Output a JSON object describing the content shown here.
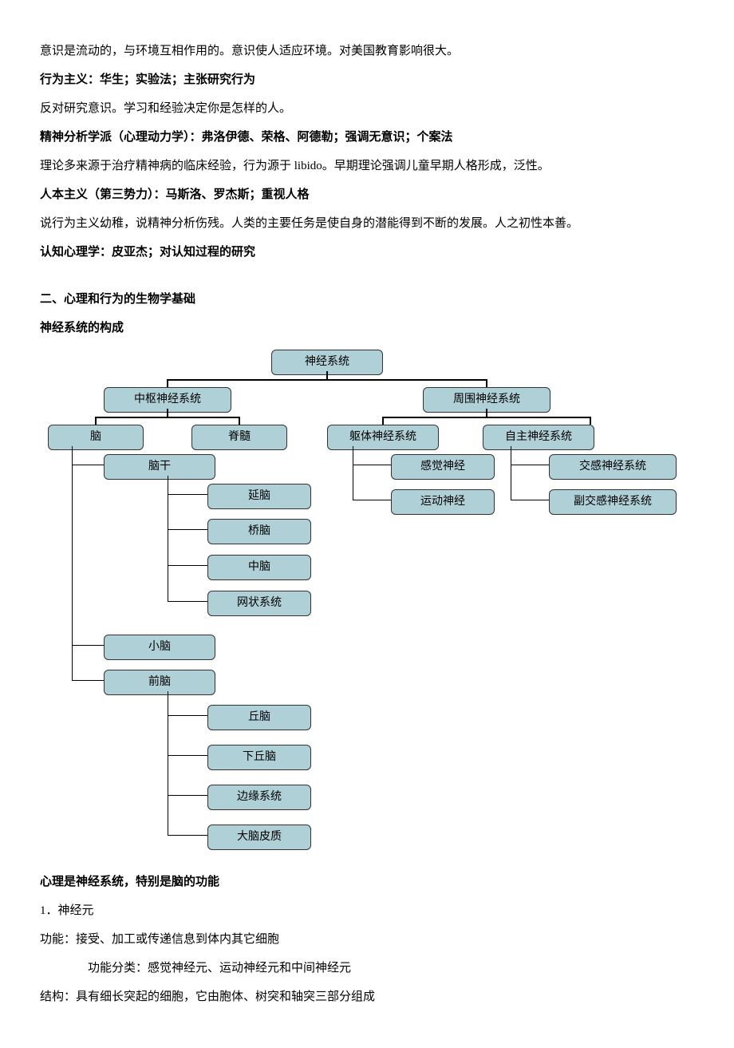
{
  "p1": "意识是流动的，与环境互相作用的。意识使人适应环境。对美国教育影响很大。",
  "h1": "行为主义：华生；实验法；主张研究行为",
  "p2": "反对研究意识。学习和经验决定你是怎样的人。",
  "h2": "精神分析学派（心理动力学）：弗洛伊德、荣格、阿德勒；强调无意识；个案法",
  "p3": "理论多来源于治疗精神病的临床经验，行为源于 libido。早期理论强调儿童早期人格形成，泛性。",
  "h3": "人本主义（第三势力）：马斯洛、罗杰斯；重视人格",
  "p4": "说行为主义幼稚，说精神分析伤残。人类的主要任务是使自身的潜能得到不断的发展。人之初性本善。",
  "h4": "认知心理学：皮亚杰；对认知过程的研究",
  "s2_title": "二、心理和行为的生物学基础",
  "s2_sub": "神经系统的构成",
  "chart_data": {
    "type": "tree",
    "root": "神经系统",
    "children": [
      {
        "label": "中枢神经系统",
        "children": [
          {
            "label": "脑",
            "children": [
              {
                "label": "脑干",
                "children": [
                  "延脑",
                  "桥脑",
                  "中脑",
                  "网状系统"
                ]
              },
              {
                "label": "小脑"
              },
              {
                "label": "前脑",
                "children": [
                  "丘脑",
                  "下丘脑",
                  "边缘系统",
                  "大脑皮质"
                ]
              }
            ]
          },
          {
            "label": "脊髓"
          }
        ]
      },
      {
        "label": "周围神经系统",
        "children": [
          {
            "label": "躯体神经系统",
            "children": [
              "感觉神经",
              "运动神经"
            ]
          },
          {
            "label": "自主神经系统",
            "children": [
              "交感神经系统",
              "副交感神经系统"
            ]
          }
        ]
      }
    ]
  },
  "nodes": {
    "root": "神经系统",
    "cns": "中枢神经系统",
    "pns": "周围神经系统",
    "brain": "脑",
    "spinal": "脊髓",
    "somatic": "躯体神经系统",
    "autonomic": "自主神经系统",
    "brainstem": "脑干",
    "medulla": "延脑",
    "pons": "桥脑",
    "midbrain": "中脑",
    "reticular": "网状系统",
    "cerebellum": "小脑",
    "forebrain": "前脑",
    "thalamus": "丘脑",
    "hypothalamus": "下丘脑",
    "limbic": "边缘系统",
    "cortex": "大脑皮质",
    "sensory": "感觉神经",
    "motor": "运动神经",
    "sympathetic": "交感神经系统",
    "parasympathetic": "副交感神经系统"
  },
  "p5": "心理是神经系统，特别是脑的功能",
  "p6": "1．神经元",
  "p7": "功能：接受、加工或传递信息到体内其它细胞",
  "p8": "功能分类：感觉神经元、运动神经元和中间神经元",
  "p9": "结构：具有细长突起的细胞，它由胞体、树突和轴突三部分组成"
}
